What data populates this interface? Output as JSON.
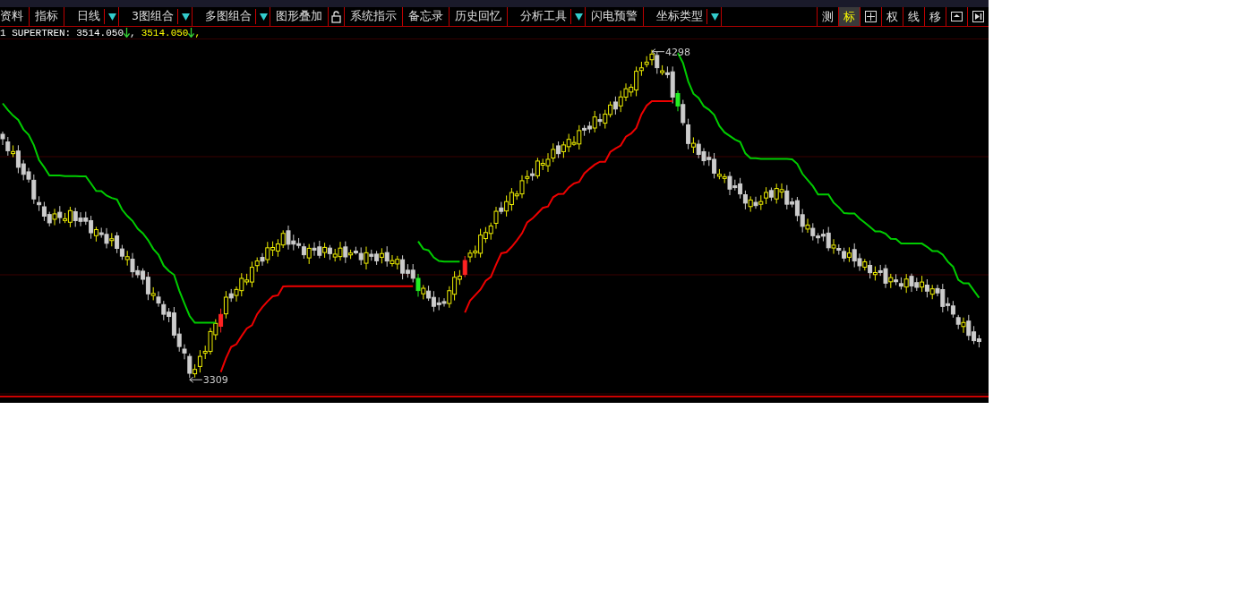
{
  "toolbar": {
    "items": [
      {
        "kind": "button",
        "label": "资料"
      },
      {
        "kind": "button",
        "label": "指标"
      },
      {
        "kind": "dropdown",
        "label": "日线"
      },
      {
        "kind": "dropdown",
        "label": "3图组合"
      },
      {
        "kind": "dropdown",
        "label": "多图组合"
      },
      {
        "kind": "button",
        "label": "图形叠加"
      },
      {
        "kind": "lock"
      },
      {
        "kind": "button",
        "label": "系统指示"
      },
      {
        "kind": "button",
        "label": "备忘录"
      },
      {
        "kind": "button",
        "label": "历史回忆"
      },
      {
        "kind": "dropdown",
        "label": "分析工具"
      },
      {
        "kind": "button",
        "label": "闪电预警"
      },
      {
        "kind": "dropdown",
        "label": "坐标类型"
      }
    ],
    "tools": [
      {
        "kind": "text",
        "label": "测",
        "selected": false
      },
      {
        "kind": "text",
        "label": "标",
        "selected": true
      },
      {
        "kind": "grid",
        "selected": false
      },
      {
        "kind": "text",
        "label": "权",
        "selected": false
      },
      {
        "kind": "text",
        "label": "线",
        "selected": false
      },
      {
        "kind": "text",
        "label": "移",
        "selected": false
      },
      {
        "kind": "panel",
        "selected": false
      },
      {
        "kind": "play",
        "selected": false
      }
    ]
  },
  "legend": {
    "name": "1 SUPERTREN:",
    "values": [
      {
        "text": "3514.050",
        "color": "#ffffff",
        "separator": ","
      },
      {
        "text": "3514.050",
        "color": "#ffff00",
        "separator": ","
      }
    ]
  },
  "chart": {
    "high_label": "4298",
    "low_label": "3309"
  }
}
